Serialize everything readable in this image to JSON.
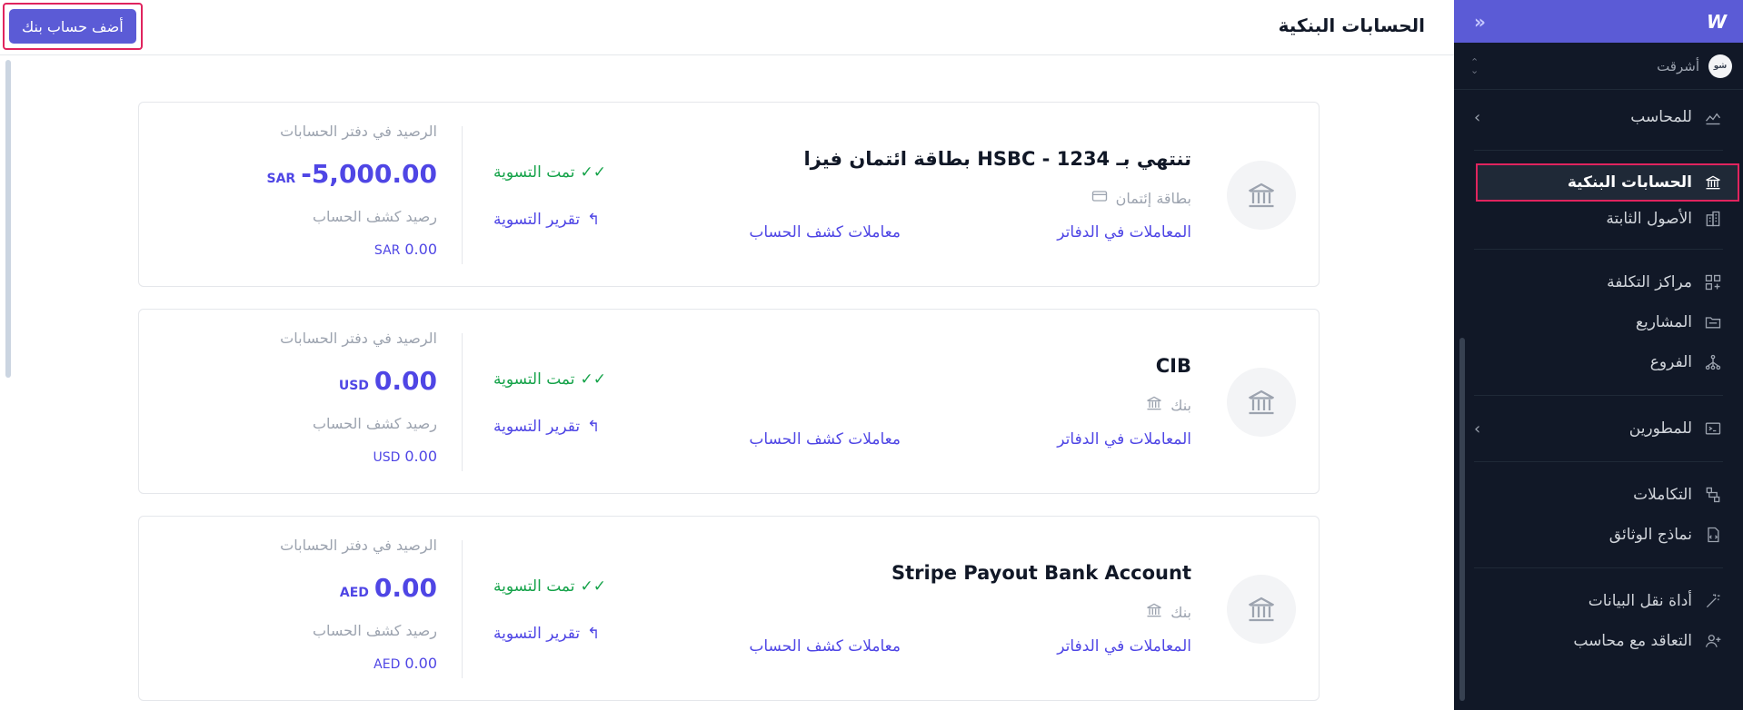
{
  "header": {
    "title": "الحسابات البنكية",
    "add_button": "أضف حساب بنك"
  },
  "sidebar": {
    "logo": "W",
    "collapse": "»",
    "org": {
      "name": "أشرقت",
      "avatar": "شو"
    },
    "groups": {
      "accountants": "للمحاسب",
      "developers": "للمطورين"
    },
    "items": {
      "bank_accounts": "الحسابات البنكية",
      "fixed_assets": "الأصول الثابتة",
      "cost_centers": "مراكز التكلفة",
      "projects": "المشاريع",
      "branches": "الفروع",
      "integrations": "التكاملات",
      "doc_templates": "نماذج الوثائق",
      "data_migration": "أداة نقل البيانات",
      "hire_accountant": "التعاقد مع محاسب"
    }
  },
  "labels": {
    "ledger_transactions": "المعاملات في الدفاتر",
    "statement_transactions": "معاملات كشف الحساب",
    "reconciled": "تمت التسوية",
    "reconciliation_report": "تقرير التسوية",
    "ledger_balance": "الرصيد في دفتر الحسابات",
    "statement_balance": "رصيد كشف الحساب"
  },
  "accounts": [
    {
      "name": "بطاقة ائتمان فيزا HSBC - تنتهي بـ 1234",
      "type": "بطاقة إئتمان",
      "ledger_amount": "-5,000.00",
      "ledger_currency": "SAR",
      "statement_amount": "0.00",
      "statement_currency": "SAR"
    },
    {
      "name": "CIB",
      "type": "بنك",
      "ledger_amount": "0.00",
      "ledger_currency": "USD",
      "statement_amount": "0.00",
      "statement_currency": "USD"
    },
    {
      "name": "Stripe Payout Bank Account",
      "type": "بنك",
      "ledger_amount": "0.00",
      "ledger_currency": "AED",
      "statement_amount": "0.00",
      "statement_currency": "AED"
    }
  ],
  "colors": {
    "accent": "#5b5bd6",
    "sidebar_bg": "#111827",
    "success": "#16a34a",
    "highlight": "#e0245e"
  }
}
